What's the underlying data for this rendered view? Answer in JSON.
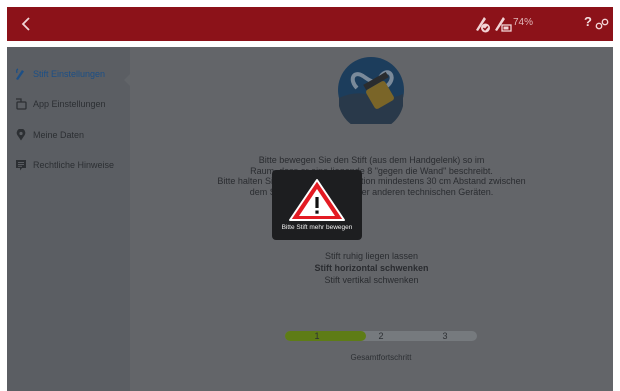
{
  "topbar": {
    "back_icon": "chevron-left-icon",
    "icons": [
      "pen-check-icon",
      "pen-battery-icon",
      "help-icon",
      "pairing-icon"
    ],
    "battery": "74%",
    "help": "?",
    "accent": "#8c1219"
  },
  "sidebar": {
    "items": [
      {
        "label": "Stift Einstellungen",
        "icon": "pen-icon",
        "active": true
      },
      {
        "label": "App Einstellungen",
        "icon": "app-icon"
      },
      {
        "label": "Meine Daten",
        "icon": "location-pin-icon"
      },
      {
        "label": "Rechtliche Hinweise",
        "icon": "document-icon"
      }
    ]
  },
  "main": {
    "emblem": "calibration-emblem",
    "instructions": [
      "Bitte bewegen Sie den Stift (aus dem Handgelenk) so im",
      "Raum, dass er eine liegende 8 \"gegen die Wand\" beschreibt.",
      "Bitte halten Sie während der Kalibration mindestens 30 cm Abstand zwischen",
      "dem Stift und dem Tablet oder anderen technischen Geräten."
    ],
    "steps": [
      {
        "text": "Stift ruhig liegen lassen",
        "bold": false
      },
      {
        "text": "Stift horizontal schwenken",
        "bold": true
      },
      {
        "text": "Stift vertikal schwenken",
        "bold": false
      }
    ],
    "progress": {
      "steps": [
        "1",
        "2",
        "3"
      ],
      "completed_fraction": 0.42,
      "color": "#5e7c16",
      "title": "Gesamtfortschritt"
    }
  },
  "toast": {
    "icon": "warning-icon",
    "message": "Bitte Stift mehr bewegen"
  }
}
